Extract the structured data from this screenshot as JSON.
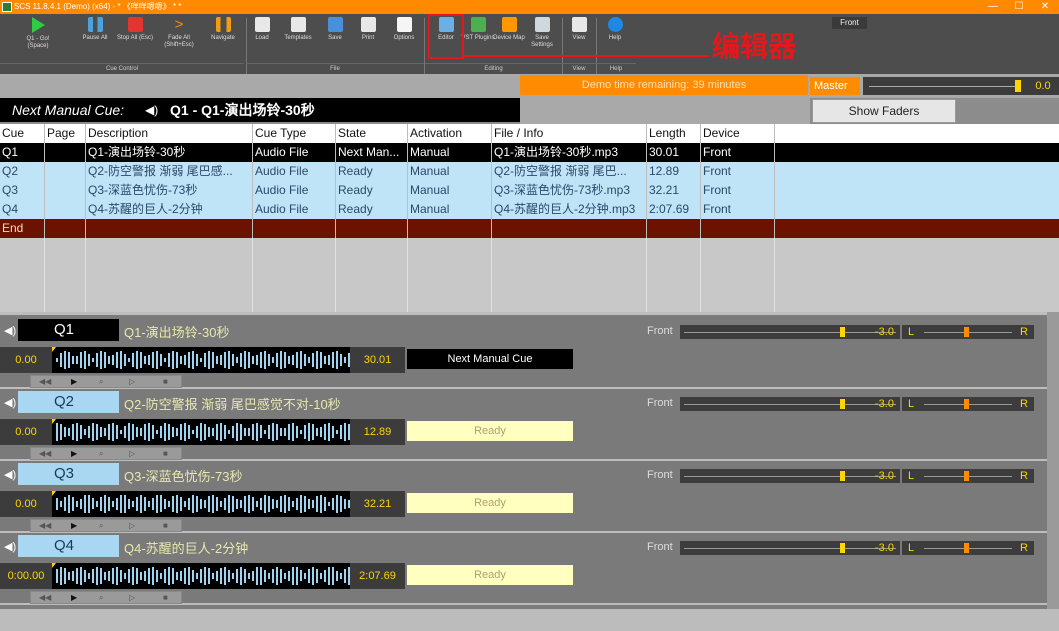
{
  "window": {
    "title": "SCS 11.8.4.1 (Demo) (x64) - * 《咩咩嗯嗯》 * *",
    "controls": [
      "—",
      "☐",
      "✕"
    ]
  },
  "toolbar": {
    "buttons": [
      {
        "name": "go-button",
        "label": "Q1 - Go! (Space)",
        "color": "#2ecc40"
      },
      {
        "name": "pause-all-button",
        "label": "Pause All",
        "color": "#4aa3df"
      },
      {
        "name": "stop-all-button",
        "label": "Stop All (Esc)",
        "color": "#e3342f"
      },
      {
        "name": "fade-all-button",
        "label": "Fade All (Shift+Esc)",
        "color": "#ff8c00"
      },
      {
        "name": "navigate-button",
        "label": "Navigate",
        "color": "#f39c12"
      },
      {
        "name": "load-button",
        "label": "Load",
        "color": "#e8e8e8"
      },
      {
        "name": "templates-button",
        "label": "Templates",
        "color": "#e8e8e8"
      },
      {
        "name": "save-button",
        "label": "Save",
        "color": "#4a90d9"
      },
      {
        "name": "print-button",
        "label": "Print",
        "color": "#e8e8e8"
      },
      {
        "name": "options-button",
        "label": "Options",
        "color": "#f5f5f5"
      },
      {
        "name": "editor-button",
        "label": "Editor",
        "color": "#6ab0e6"
      },
      {
        "name": "vst-plugins-button",
        "label": "VST Plugins",
        "color": "#4caf50"
      },
      {
        "name": "device-map-button",
        "label": "Device Map",
        "color": "#ff9800"
      },
      {
        "name": "save-settings-button",
        "label": "Save Settings",
        "color": "#cfd8dc"
      },
      {
        "name": "view-button",
        "label": "View",
        "color": "#e8e8e8"
      },
      {
        "name": "help-button",
        "label": "Help",
        "color": "#1e88e5"
      }
    ],
    "groups": [
      "Cue Control",
      "File",
      "Editing",
      "View",
      "Help"
    ],
    "front_badge": "Front"
  },
  "annotation": {
    "text": "编辑器",
    "color": "#e8161b"
  },
  "status": {
    "demo_text": "Demo time remaining: 39 minutes",
    "master_label": "Master",
    "master_value": "0.0",
    "show_faders": "Show Faders"
  },
  "next_manual_cue": {
    "label": "Next Manual Cue:",
    "cue": "Q1 - Q1-演出场铃-30秒"
  },
  "grid": {
    "columns": [
      "Cue",
      "Page",
      "Description",
      "Cue Type",
      "State",
      "Activation",
      "File / Info",
      "Length",
      "Device"
    ],
    "rows": [
      {
        "cue": "Q1",
        "page": "",
        "description": "Q1-演出场铃-30秒",
        "type": "Audio File",
        "state": "Next Man...",
        "activation": "Manual",
        "file": "Q1-演出场铃-30秒.mp3",
        "length": "30.01",
        "device": "Front"
      },
      {
        "cue": "Q2",
        "page": "",
        "description": "Q2-防空警报 渐弱 尾巴感...",
        "type": "Audio File",
        "state": "Ready",
        "activation": "Manual",
        "file": "Q2-防空警报 渐弱 尾巴...",
        "length": "12.89",
        "device": "Front"
      },
      {
        "cue": "Q3",
        "page": "",
        "description": "Q3-深蓝色忧伤-73秒",
        "type": "Audio File",
        "state": "Ready",
        "activation": "Manual",
        "file": "Q3-深蓝色忧伤-73秒.mp3",
        "length": "32.21",
        "device": "Front"
      },
      {
        "cue": "Q4",
        "page": "",
        "description": "Q4-苏醒的巨人-2分钟",
        "type": "Audio File",
        "state": "Ready",
        "activation": "Manual",
        "file": "Q4-苏醒的巨人-2分钟.mp3",
        "length": "2:07.69",
        "device": "Front"
      }
    ],
    "end_label": "End"
  },
  "panels": [
    {
      "cue": "Q1",
      "title": "Q1-演出场铃-30秒",
      "position": "0.00",
      "length": "30.01",
      "state": "Next Manual Cue",
      "device": "Front",
      "level": "-3.0",
      "pan_l": "L",
      "pan_r": "R"
    },
    {
      "cue": "Q2",
      "title": "Q2-防空警报 渐弱 尾巴感觉不对-10秒",
      "position": "0.00",
      "length": "12.89",
      "state": "Ready",
      "device": "Front",
      "level": "-3.0",
      "pan_l": "L",
      "pan_r": "R"
    },
    {
      "cue": "Q3",
      "title": "Q3-深蓝色忧伤-73秒",
      "position": "0.00",
      "length": "32.21",
      "state": "Ready",
      "device": "Front",
      "level": "-3.0",
      "pan_l": "L",
      "pan_r": "R"
    },
    {
      "cue": "Q4",
      "title": "Q4-苏醒的巨人-2分钟",
      "position": "0:00.00",
      "length": "2:07.69",
      "state": "Ready",
      "device": "Front",
      "level": "-3.0",
      "pan_l": "L",
      "pan_r": "R"
    }
  ],
  "transport_icons": [
    "rewind-icon",
    "play-icon",
    "search-icon",
    "fast-forward-icon",
    "stop-icon"
  ]
}
